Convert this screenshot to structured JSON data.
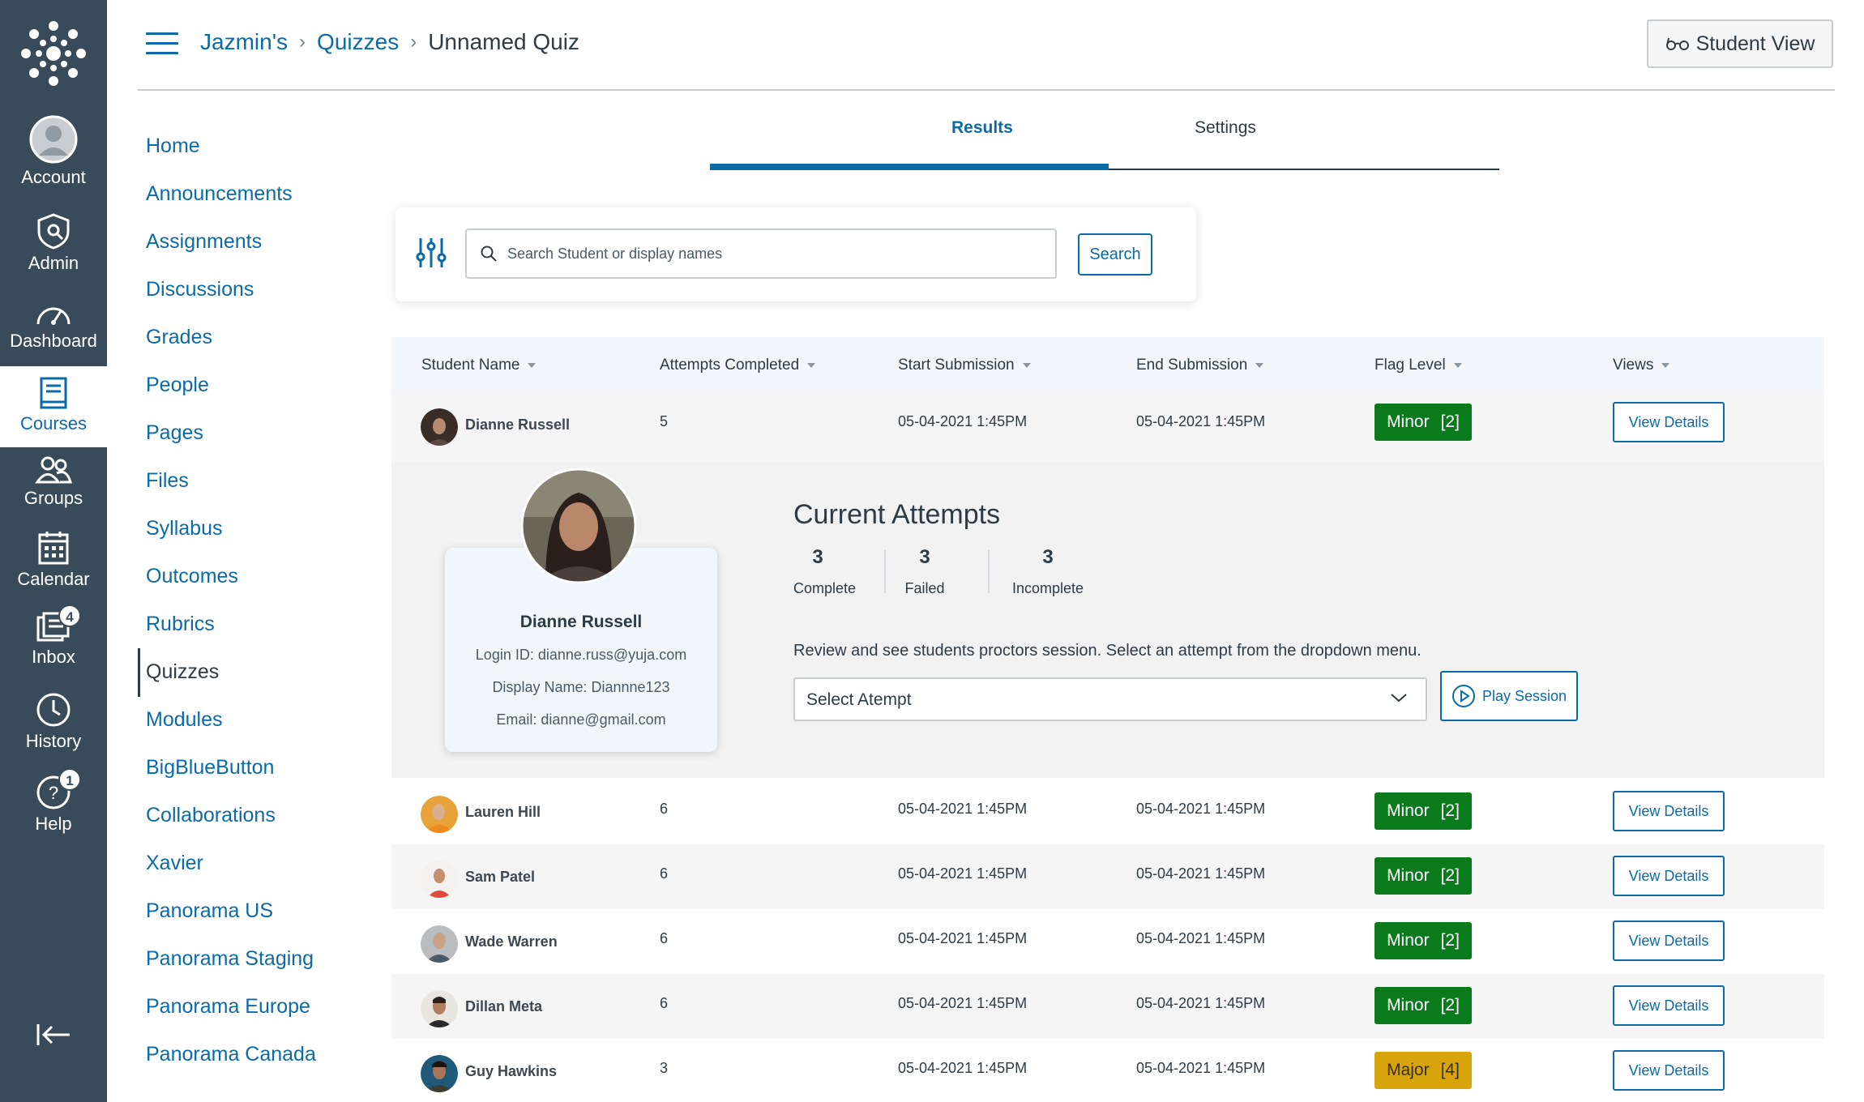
{
  "global_nav": {
    "items": [
      {
        "label": "Account",
        "icon": "account-icon"
      },
      {
        "label": "Admin",
        "icon": "admin-icon"
      },
      {
        "label": "Dashboard",
        "icon": "dashboard-icon"
      },
      {
        "label": "Courses",
        "icon": "courses-icon",
        "active": true
      },
      {
        "label": "Groups",
        "icon": "groups-icon"
      },
      {
        "label": "Calendar",
        "icon": "calendar-icon"
      },
      {
        "label": "Inbox",
        "icon": "inbox-icon",
        "badge": "4"
      },
      {
        "label": "History",
        "icon": "history-icon"
      },
      {
        "label": "Help",
        "icon": "help-icon",
        "badge": "1"
      }
    ],
    "collapse_icon": "collapse-icon",
    "nav_bg": "#394b58",
    "accent": "#0b6aa8"
  },
  "header": {
    "breadcrumbs": [
      "Jazmin's",
      "Quizzes",
      "Unnamed Quiz"
    ],
    "student_view_label": "Student View"
  },
  "course_nav": {
    "items": [
      {
        "label": "Home"
      },
      {
        "label": "Announcements"
      },
      {
        "label": "Assignments"
      },
      {
        "label": "Discussions"
      },
      {
        "label": "Grades"
      },
      {
        "label": "People"
      },
      {
        "label": "Pages"
      },
      {
        "label": "Files"
      },
      {
        "label": "Syllabus"
      },
      {
        "label": "Outcomes",
        "hidden_icon": true
      },
      {
        "label": "Rubrics"
      },
      {
        "label": "Quizzes",
        "active": true
      },
      {
        "label": "Modules",
        "hidden_icon": true
      },
      {
        "label": "BigBlueButton"
      },
      {
        "label": "Collaborations"
      },
      {
        "label": "Xavier"
      },
      {
        "label": "Panorama US"
      },
      {
        "label": "Panorama Staging"
      },
      {
        "label": "Panorama Europe"
      },
      {
        "label": "Panorama Canada"
      }
    ]
  },
  "tabs": {
    "results": "Results",
    "settings": "Settings",
    "active": "results"
  },
  "search": {
    "placeholder": "Search Student or display names",
    "value": "",
    "button": "Search"
  },
  "table": {
    "columns": [
      "Student Name",
      "Attempts Completed",
      "Start Submission",
      "End Submission",
      "Flag Level",
      "Views"
    ],
    "view_details_label": "View Details",
    "rows": [
      {
        "name": "Dianne Russell",
        "attempts": "5",
        "start": "05-04-2021 1:45PM",
        "end": "05-04-2021 1:45PM",
        "flag": "Minor",
        "flag_count": "[2]",
        "flag_color": "#0a7a1c"
      },
      {
        "name": "Lauren Hill",
        "attempts": "6",
        "start": "05-04-2021 1:45PM",
        "end": "05-04-2021 1:45PM",
        "flag": "Minor",
        "flag_count": "[2]",
        "flag_color": "#0a7a1c"
      },
      {
        "name": "Sam Patel",
        "attempts": "6",
        "start": "05-04-2021 1:45PM",
        "end": "05-04-2021 1:45PM",
        "flag": "Minor",
        "flag_count": "[2]",
        "flag_color": "#0a7a1c"
      },
      {
        "name": "Wade Warren",
        "attempts": "6",
        "start": "05-04-2021 1:45PM",
        "end": "05-04-2021 1:45PM",
        "flag": "Minor",
        "flag_count": "[2]",
        "flag_color": "#0a7a1c"
      },
      {
        "name": "Dillan Meta",
        "attempts": "6",
        "start": "05-04-2021 1:45PM",
        "end": "05-04-2021 1:45PM",
        "flag": "Minor",
        "flag_count": "[2]",
        "flag_color": "#0a7a1c"
      },
      {
        "name": "Guy Hawkins",
        "attempts": "3",
        "start": "05-04-2021 1:45PM",
        "end": "05-04-2021 1:45PM",
        "flag": "Major",
        "flag_count": "[4]",
        "flag_color": "#d8a40c"
      }
    ]
  },
  "expanded": {
    "profile": {
      "name": "Dianne Russell",
      "login": "Login ID: dianne.russ@yuja.com",
      "display": "Display Name: Diannne123",
      "email": "Email: dianne@gmail.com"
    },
    "title": "Current Attempts",
    "stats": [
      {
        "value": "3",
        "label": "Complete"
      },
      {
        "value": "3",
        "label": "Failed"
      },
      {
        "value": "3",
        "label": "Incomplete"
      }
    ],
    "description": "Review and see students proctors session. Select an attempt from the dropdown menu.",
    "select_value": "Select Atempt",
    "play_label": "Play Session"
  }
}
